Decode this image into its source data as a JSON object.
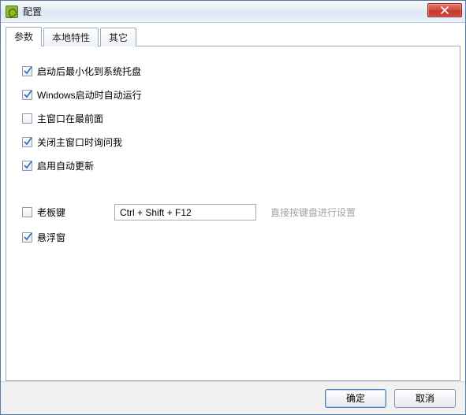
{
  "window": {
    "title": "配置"
  },
  "tabs": [
    {
      "label": "参数",
      "active": true
    },
    {
      "label": "本地特性",
      "active": false
    },
    {
      "label": "其它",
      "active": false
    }
  ],
  "options": {
    "minimize_to_tray": {
      "label": "启动后最小化到系统托盘",
      "checked": true
    },
    "run_on_startup": {
      "label": "Windows启动时自动运行",
      "checked": true
    },
    "always_on_top": {
      "label": "主窗口在最前面",
      "checked": false
    },
    "confirm_on_close": {
      "label": "关闭主窗口时询问我",
      "checked": true
    },
    "auto_update": {
      "label": "启用自动更新",
      "checked": true
    },
    "boss_key": {
      "label": "老板键",
      "checked": false
    },
    "float_window": {
      "label": "悬浮窗",
      "checked": true
    }
  },
  "hotkey": {
    "value": "Ctrl + Shift + F12",
    "hint": "直接按键盘进行设置"
  },
  "buttons": {
    "ok": "确定",
    "cancel": "取消"
  }
}
